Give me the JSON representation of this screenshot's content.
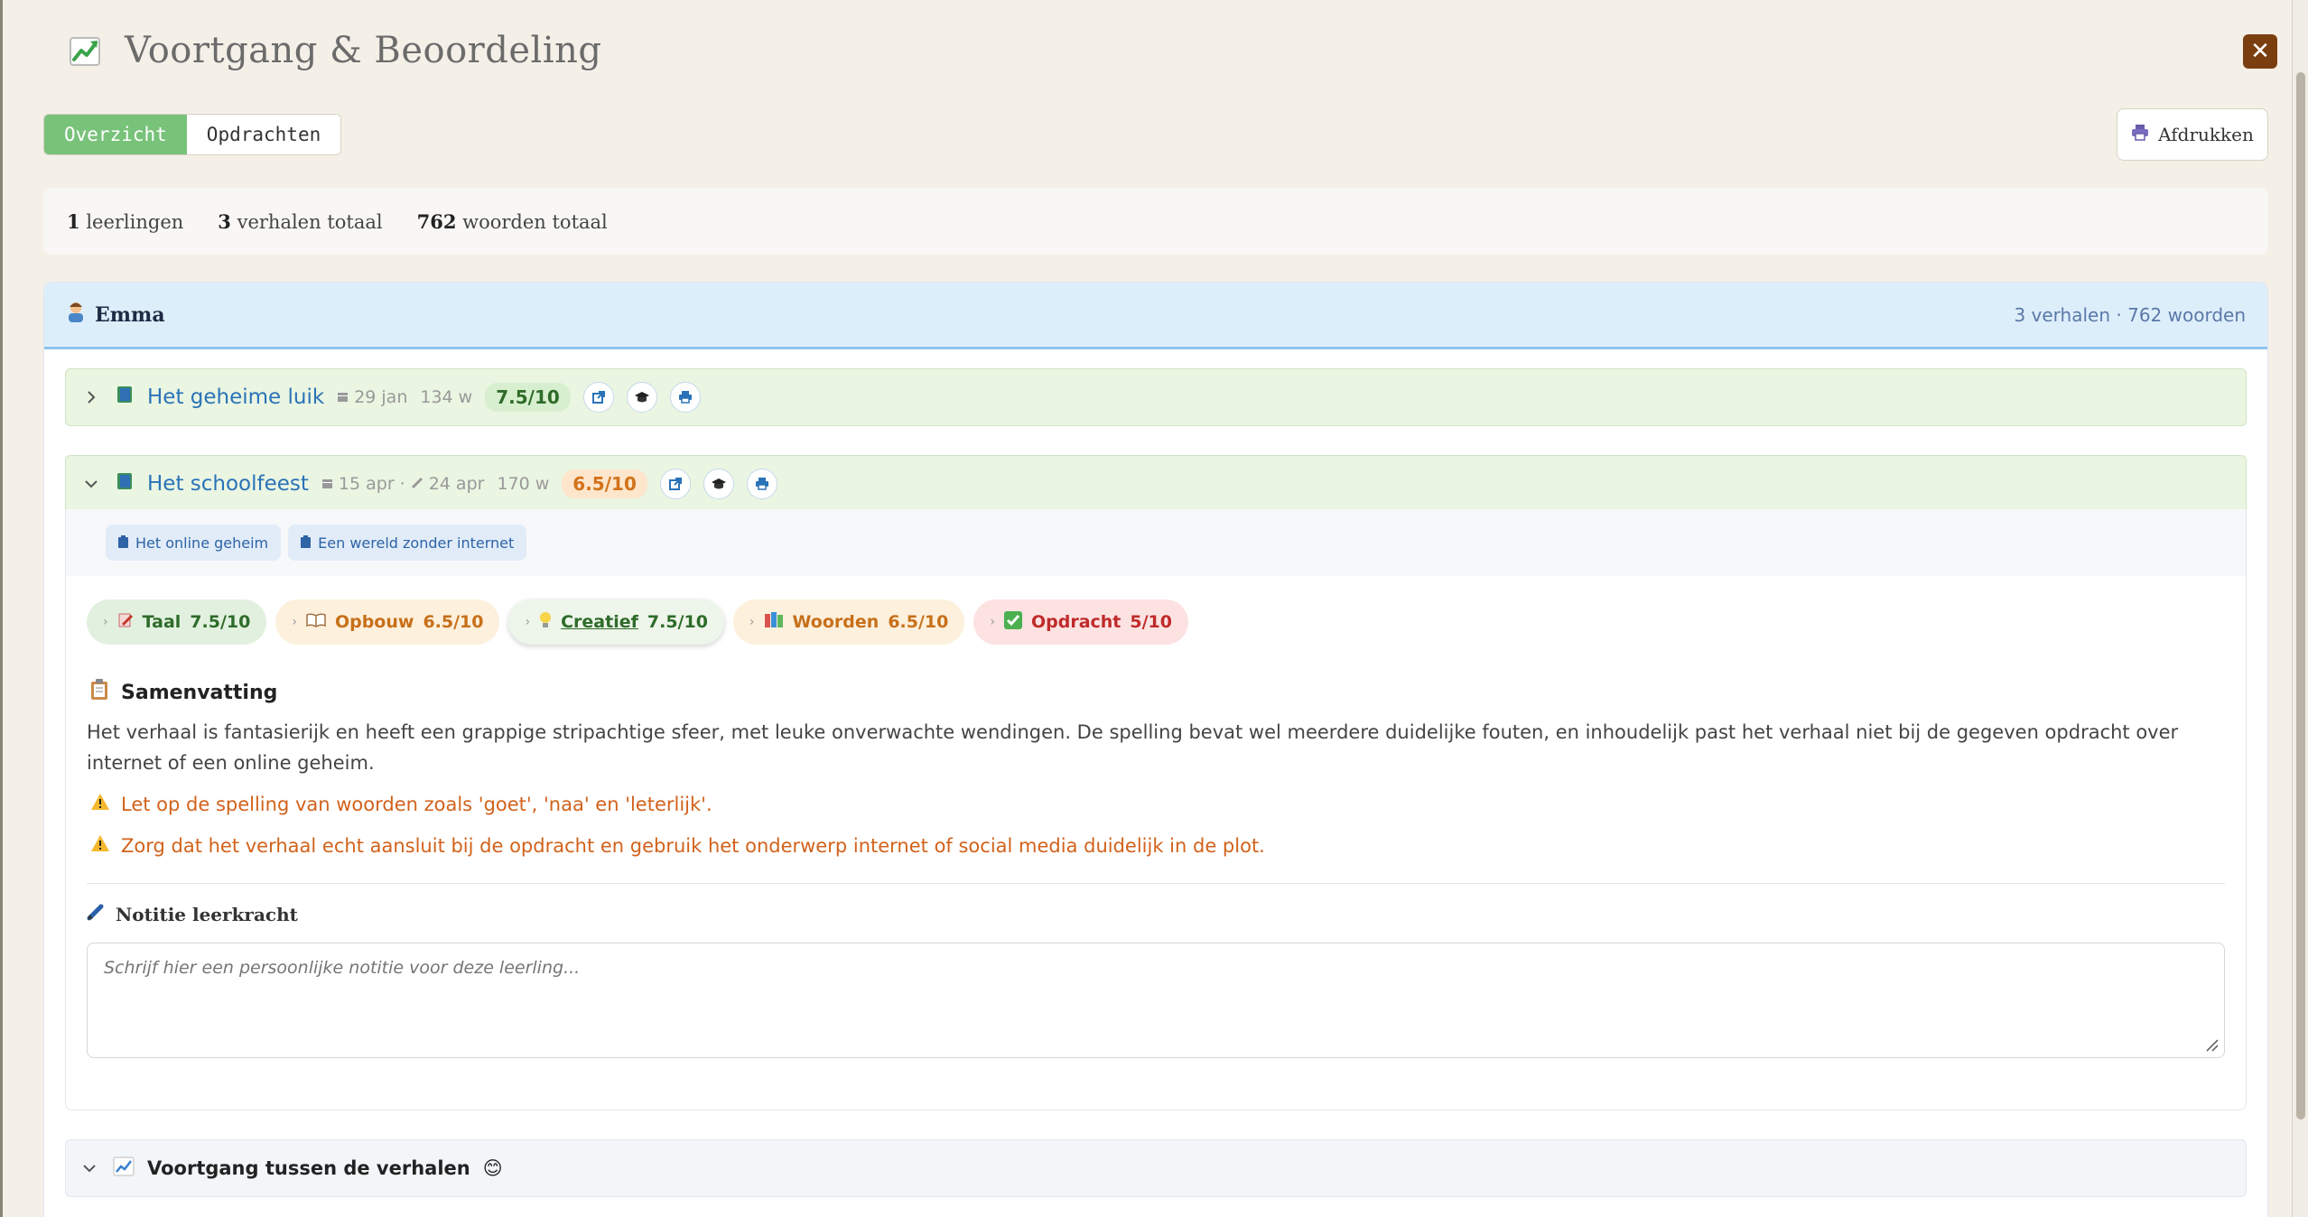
{
  "window": {
    "title": "Voortgang & Beoordeling",
    "close_label": "✕"
  },
  "tabs": [
    {
      "label": "Overzicht",
      "active": true
    },
    {
      "label": "Opdrachten",
      "active": false
    }
  ],
  "toolbar": {
    "print_label": "Afdrukken"
  },
  "stats": {
    "students_count": "1",
    "students_label": "leerlingen",
    "stories_count": "3",
    "stories_label": "verhalen totaal",
    "words_count": "762",
    "words_label": "woorden totaal"
  },
  "student": {
    "name": "Emma",
    "meta": "3 verhalen · 762 woorden"
  },
  "stories": [
    {
      "title": "Het geheime luik",
      "date": "29 jan",
      "words": "134 w",
      "grade": "7.5/10"
    },
    {
      "title": "Het schoolfeest",
      "date": "15 apr",
      "date_sep": "·",
      "edited": "24 apr",
      "words": "170 w",
      "grade": "6.5/10"
    }
  ],
  "assignments": [
    "Het online geheim",
    "Een wereld zonder internet"
  ],
  "criteria": [
    {
      "label": "Taal",
      "score": "7.5/10"
    },
    {
      "label": "Opbouw",
      "score": "6.5/10"
    },
    {
      "label": "Creatief",
      "score": "7.5/10"
    },
    {
      "label": "Woorden",
      "score": "6.5/10"
    },
    {
      "label": "Opdracht",
      "score": "5/10"
    }
  ],
  "summary": {
    "title": "Samenvatting",
    "text": "Het verhaal is fantasierijk en heeft een grappige stripachtige sfeer, met leuke onverwachte wendingen. De spelling bevat wel meerdere duidelijke fouten, en inhoudelijk past het verhaal niet bij de gegeven opdracht over internet of een online geheim.",
    "warnings": [
      "Let op de spelling van woorden zoals 'goet', 'naa' en 'leterlijk'.",
      "Zorg dat het verhaal echt aansluit bij de opdracht en gebruik het onderwerp internet of social media duidelijk in de plot."
    ]
  },
  "note": {
    "title": "Notitie leerkracht",
    "placeholder": "Schrijf hier een persoonlijke notitie voor deze leerling..."
  },
  "progress": {
    "title": "Voortgang tussen de verhalen",
    "emoji": "😊"
  },
  "colors": {
    "accent_green": "#78c27a",
    "close_brown": "#7b3f0f",
    "link_blue": "#2a73b8",
    "warn_orange": "#d2621b"
  },
  "icons": [
    "chart-up-icon",
    "close-icon",
    "printer-icon",
    "person-icon",
    "book-icon",
    "calendar-icon",
    "pencil-icon",
    "external-link-icon",
    "graduation-cap-icon",
    "clipboard-icon",
    "warning-icon",
    "memo-icon",
    "chevron-right-icon",
    "chevron-down-icon",
    "lightbulb-icon",
    "books-icon",
    "checkbox-icon"
  ]
}
